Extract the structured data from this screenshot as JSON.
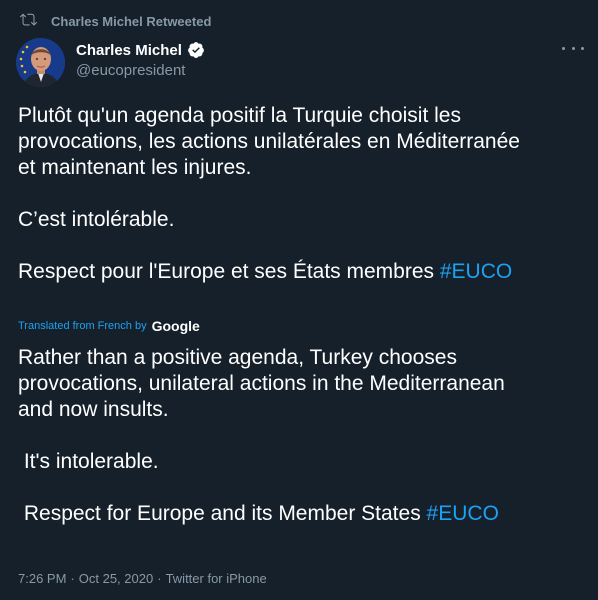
{
  "retweet": {
    "icon": "retweet-icon",
    "label": "Charles Michel Retweeted"
  },
  "author": {
    "name": "Charles Michel",
    "handle": "@eucopresident",
    "verified_icon": "verified-badge-icon"
  },
  "menu": {
    "icon": "more-options-icon"
  },
  "tweet": {
    "original_lines": [
      "Plutôt qu'un agenda positif la Turquie choisit les",
      "provocations, les actions unilatérales en Méditerranée",
      "et maintenant les injures.",
      "",
      "C’est intolérable.",
      "",
      "Respect pour l'Europe et ses États membres "
    ],
    "original_hashtag": "#EUCO",
    "translation_label": "Translated from French by",
    "translation_brand": "Google",
    "translated_lines": [
      "Rather than a positive agenda, Turkey chooses",
      "provocations, unilateral actions in the Mediterranean",
      "and now insults.",
      "",
      " It's intolerable.",
      "",
      " Respect for Europe and its Member States "
    ],
    "translated_hashtag": "#EUCO"
  },
  "meta": {
    "time": "7:26 PM",
    "separator1": "·",
    "date": "Oct 25, 2020",
    "separator2": "·",
    "source": "Twitter for iPhone"
  },
  "colors": {
    "background": "#15202b",
    "text": "#ffffff",
    "muted": "#8899a6",
    "accent": "#1da1f2"
  }
}
